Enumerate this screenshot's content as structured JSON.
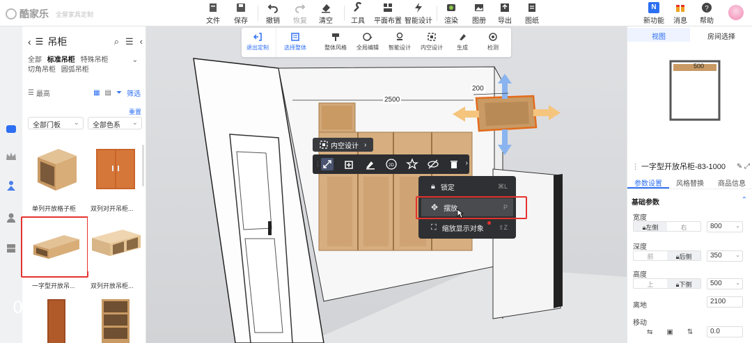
{
  "app": {
    "name": "酷家乐",
    "tagline": "全屋家具定制"
  },
  "toolbar": [
    {
      "label": "文件",
      "icon": "file-icon"
    },
    {
      "label": "保存",
      "icon": "save-icon"
    },
    {
      "label": "撤销",
      "icon": "undo-icon"
    },
    {
      "label": "恢复",
      "icon": "redo-icon",
      "disabled": true
    },
    {
      "label": "清空",
      "icon": "eraser-icon"
    },
    {
      "label": "工具",
      "icon": "wrench-icon"
    },
    {
      "label": "平面布置",
      "icon": "floorplan-icon"
    },
    {
      "label": "智能设计",
      "icon": "bolt-icon"
    },
    {
      "label": "渲染",
      "icon": "render-icon"
    },
    {
      "label": "图册",
      "icon": "album-icon"
    },
    {
      "label": "导出",
      "icon": "export-icon"
    },
    {
      "label": "图纸",
      "icon": "drawing-icon"
    }
  ],
  "toolbar_right": [
    {
      "label": "新功能",
      "icon": "new-feature-icon",
      "badge": "N"
    },
    {
      "label": "消息",
      "icon": "gift-icon"
    },
    {
      "label": "帮助",
      "icon": "help-icon"
    }
  ],
  "subbar": [
    {
      "label": "退出定制",
      "icon": "exit-icon",
      "active": true
    },
    {
      "label": "选择整体",
      "icon": "select-all-icon",
      "active": true
    },
    {
      "label": "整体风格",
      "icon": "style-icon"
    },
    {
      "label": "全局编辑",
      "icon": "global-edit-icon"
    },
    {
      "label": "智能设计",
      "icon": "smart-design-icon"
    },
    {
      "label": "内空设计",
      "icon": "inner-space-icon"
    },
    {
      "label": "生成",
      "icon": "generate-icon"
    },
    {
      "label": "检测",
      "icon": "check-icon"
    }
  ],
  "left": {
    "title": "吊柜",
    "filters": [
      {
        "label": "全部"
      },
      {
        "label": "标准吊柜",
        "active": true
      },
      {
        "label": "特殊吊柜"
      },
      {
        "label": "切角吊柜"
      },
      {
        "label": "圆弧吊柜"
      }
    ],
    "sort_label": "最高",
    "filter_label": "筛选",
    "reset_label": "重置",
    "door_select": "全部门板",
    "color_select": "全部色系",
    "products": [
      {
        "label": "单列开放格子柜"
      },
      {
        "label": "双列对开吊柜..."
      },
      {
        "label": "一字型开放吊..."
      },
      {
        "label": "双列开放吊柜..."
      }
    ]
  },
  "canvas": {
    "dim_width": "2500",
    "dim_depth": "200",
    "popup_title": "内空设计",
    "context_menu": [
      {
        "label": "锁定",
        "shortcut": "⌘L",
        "icon": "lock-icon"
      },
      {
        "label": "摆放",
        "shortcut": "P",
        "icon": "move-icon",
        "highlighted": true
      },
      {
        "label": "缩放显示对象",
        "shortcut": "⇧Z",
        "icon": "zoom-fit-icon"
      }
    ],
    "step_number": "05"
  },
  "right": {
    "tabs": [
      {
        "label": "视图",
        "active": true
      },
      {
        "label": "房间选择"
      }
    ],
    "minimap_label": "500",
    "product_title": "一字型开放吊柜-83-1000",
    "subtabs": [
      {
        "label": "参数设置",
        "active": true
      },
      {
        "label": "风格替换"
      },
      {
        "label": "商品信息"
      }
    ],
    "section": "基础参数",
    "params": [
      {
        "label": "宽度",
        "seg": [
          "左侧",
          "右"
        ],
        "seg_active": 0,
        "value": "800"
      },
      {
        "label": "深度",
        "seg": [
          "前",
          "后侧"
        ],
        "seg_active": 1,
        "value": "350"
      },
      {
        "label": "高度",
        "seg": [
          "上",
          "下侧"
        ],
        "seg_active": 1,
        "value": "500"
      }
    ],
    "offground_label": "离地",
    "offground_value": "2100",
    "move_label": "移动",
    "move_value": "0.0"
  },
  "colors": {
    "accent": "#2d6ff2",
    "highlight": "#e5322d",
    "wood": "#c99a64"
  }
}
